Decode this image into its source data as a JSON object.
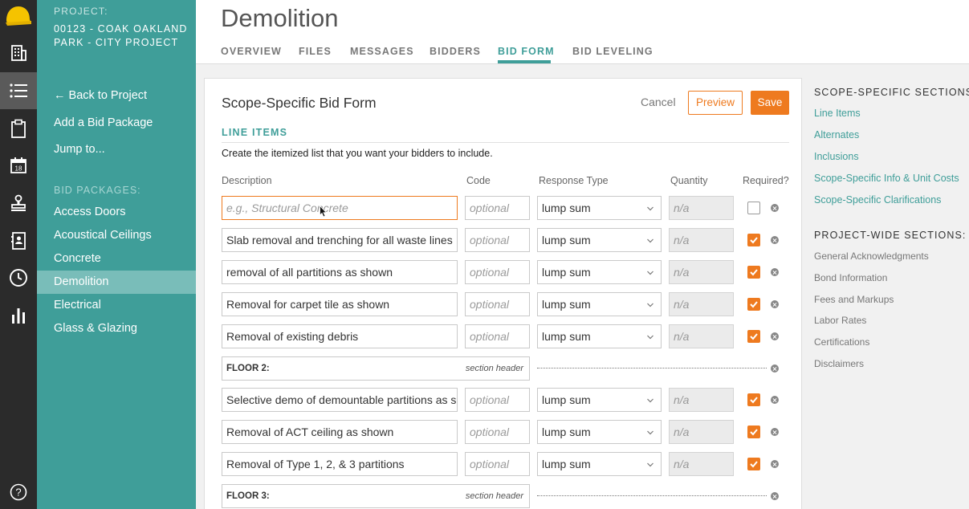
{
  "colors": {
    "teal": "#3f9e99",
    "orange": "#ee7a1f",
    "rail": "#2b2b2b"
  },
  "rail": {
    "icons": [
      "hardhat-logo-icon",
      "building-icon",
      "list-icon",
      "clipboard-icon",
      "calendar-icon",
      "stamp-icon",
      "contacts-book-icon",
      "clock-icon",
      "bar-chart-icon",
      "help-icon"
    ],
    "calendar_day": "18",
    "help_glyph": "?"
  },
  "sidebar": {
    "project_label": "PROJECT:",
    "project_name": "00123 - COAK OAKLAND PARK - CITY PROJECT",
    "back_label": "← Back to Project",
    "add_label": "Add a Bid Package",
    "jump_label": "Jump to...",
    "packages_label": "BID PACKAGES:",
    "packages": [
      "Access Doors",
      "Acoustical Ceilings",
      "Concrete",
      "Demolition",
      "Electrical",
      "Glass & Glazing"
    ],
    "active_package": "Demolition"
  },
  "header": {
    "title": "Demolition",
    "tabs": [
      "OVERVIEW",
      "FILES",
      "MESSAGES",
      "BIDDERS",
      "BID FORM",
      "BID LEVELING"
    ],
    "active_tab": "BID FORM"
  },
  "form": {
    "title": "Scope-Specific Bid Form",
    "cancel": "Cancel",
    "preview": "Preview",
    "save": "Save",
    "section": "LINE ITEMS",
    "description": "Create the itemized list that you want your bidders to include.",
    "columns": {
      "description": "Description",
      "code": "Code",
      "response": "Response Type",
      "quantity": "Quantity",
      "required": "Required?"
    },
    "desc_placeholder": "e.g., Structural Concrete",
    "code_placeholder": "optional",
    "qty_placeholder": "n/a",
    "section_header_tag": "section header",
    "rows": [
      {
        "type": "item",
        "description": "",
        "response": "lump sum",
        "required": false
      },
      {
        "type": "item",
        "description": "Slab removal and trenching for all waste lines",
        "response": "lump sum",
        "required": true
      },
      {
        "type": "item",
        "description": "removal of all partitions as shown",
        "response": "lump sum",
        "required": true
      },
      {
        "type": "item",
        "description": "Removal for carpet tile as shown",
        "response": "lump sum",
        "required": true
      },
      {
        "type": "item",
        "description": "Removal of existing debris",
        "response": "lump sum",
        "required": true
      },
      {
        "type": "header",
        "name": "FLOOR 2:"
      },
      {
        "type": "item",
        "description": "Selective demo of demountable partitions as s",
        "response": "lump sum",
        "required": true
      },
      {
        "type": "item",
        "description": "Removal of ACT ceiling as shown",
        "response": "lump sum",
        "required": true
      },
      {
        "type": "item",
        "description": "Removal of Type 1, 2, & 3 partitions",
        "response": "lump sum",
        "required": true
      },
      {
        "type": "header",
        "name": "FLOOR 3:"
      }
    ]
  },
  "right_panel": {
    "scope_heading": "SCOPE-SPECIFIC SECTIONS",
    "scope_links": [
      "Line Items",
      "Alternates",
      "Inclusions",
      "Scope-Specific Info & Unit Costs",
      "Scope-Specific Clarifications"
    ],
    "project_heading": "PROJECT-WIDE SECTIONS:",
    "project_links": [
      "General Acknowledgments",
      "Bond Information",
      "Fees and Markups",
      "Labor Rates",
      "Certifications",
      "Disclaimers"
    ]
  }
}
